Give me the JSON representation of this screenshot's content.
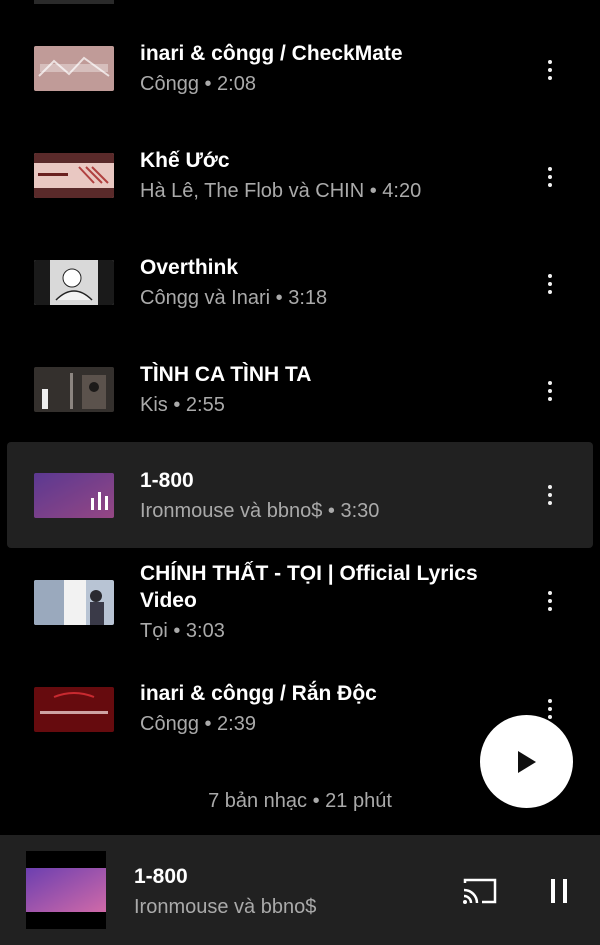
{
  "playlist": {
    "tracks": [
      {
        "title": "inari & côngg / CheckMate",
        "subtitle": "Côngg • 2:08",
        "thumb_icon": "checkmate-thumbnail",
        "active": false
      },
      {
        "title": "Khế Ước",
        "subtitle": "Hà Lê, The Flob và CHIN • 4:20",
        "thumb_icon": "khe-uoc-thumbnail",
        "active": false
      },
      {
        "title": "Overthink",
        "subtitle": "Côngg và Inari • 3:18",
        "thumb_icon": "overthink-thumbnail",
        "active": false
      },
      {
        "title": "TÌNH CA TÌNH TA",
        "subtitle": "Kis • 2:55",
        "thumb_icon": "tinh-ca-tinh-ta-thumbnail",
        "active": false
      },
      {
        "title": "1-800",
        "subtitle": "Ironmouse và bbno$ • 3:30",
        "thumb_icon": "1-800-thumbnail",
        "active": true
      },
      {
        "title": "CHÍNH THẤT - TỌI | Official Lyrics Video",
        "subtitle": "Tọi • 3:03",
        "thumb_icon": "chinh-that-thumbnail",
        "active": false
      },
      {
        "title": "inari & côngg / Rắn Độc",
        "subtitle": "Côngg • 2:39",
        "thumb_icon": "ran-doc-thumbnail",
        "active": false
      }
    ],
    "summary": "7 bản nhạc • 21 phút"
  },
  "now_playing": {
    "title": "1-800",
    "artist": "Ironmouse và bbno$"
  },
  "icons": {
    "menu": "more-vert-icon",
    "play": "play-icon",
    "cast": "cast-icon",
    "pause": "pause-icon"
  },
  "colors": {
    "background": "#000000",
    "active_row": "#212121",
    "mini_player": "#212121",
    "primary_text": "#ffffff",
    "secondary_text": "#aaaaaa"
  }
}
